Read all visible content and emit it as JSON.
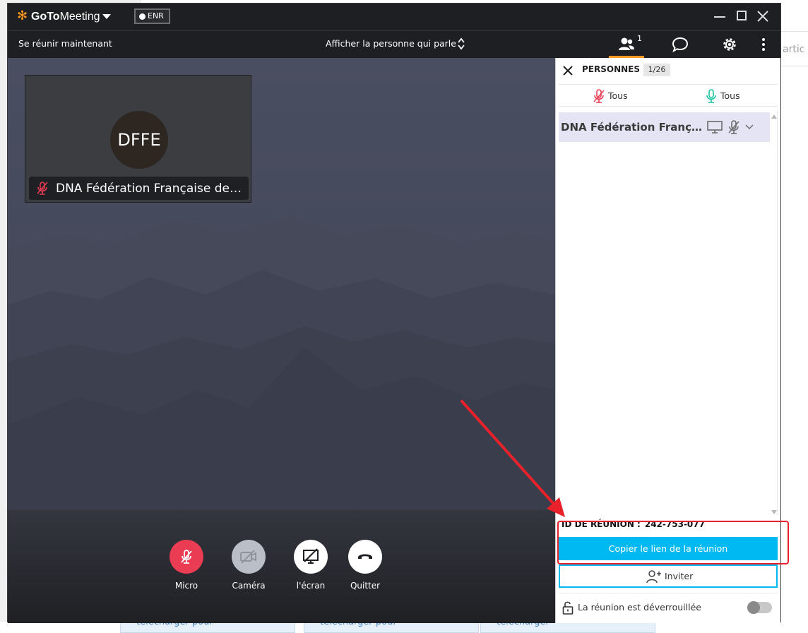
{
  "app": {
    "brand_bold": "GoTo",
    "brand_rest": "Meeting",
    "record_label": "ENR"
  },
  "toolbar": {
    "meet_now": "Se réunir maintenant",
    "view_mode": "Afficher la personne qui parle",
    "people_count": "1"
  },
  "video": {
    "avatar_initials": "DFFE",
    "participant_label": "DNA Fédération Française des E..."
  },
  "controls": [
    {
      "label": "Micro",
      "color": "#ea3c53"
    },
    {
      "label": "Caméra",
      "color": "#b9bec7"
    },
    {
      "label": "l'écran",
      "color": "#ffffff"
    },
    {
      "label": "Quitter",
      "color": "#ffffff"
    }
  ],
  "panel": {
    "title": "PERSONNES",
    "count": "1/26",
    "mute_all": "Tous",
    "unmute_all": "Tous",
    "participant_name": "DNA Fédération Français...",
    "meeting_id_label": "ID DE RÉUNION :",
    "meeting_id_value": "242-753-077",
    "copy_link": "Copier le lien de la réunion",
    "invite": "Inviter",
    "lock_status": "La réunion est déverrouillée"
  },
  "background_page": {
    "right_text": "artic",
    "card_texts": [
      "télécharger pour",
      "télécharger pour",
      "télécharger"
    ]
  },
  "colors": {
    "accent": "#ff9a1f",
    "link_blue": "#00b8f2",
    "mute_red": "#ea3c53",
    "unmute_green": "#19c29b",
    "annotation_red": "#e8212a"
  }
}
